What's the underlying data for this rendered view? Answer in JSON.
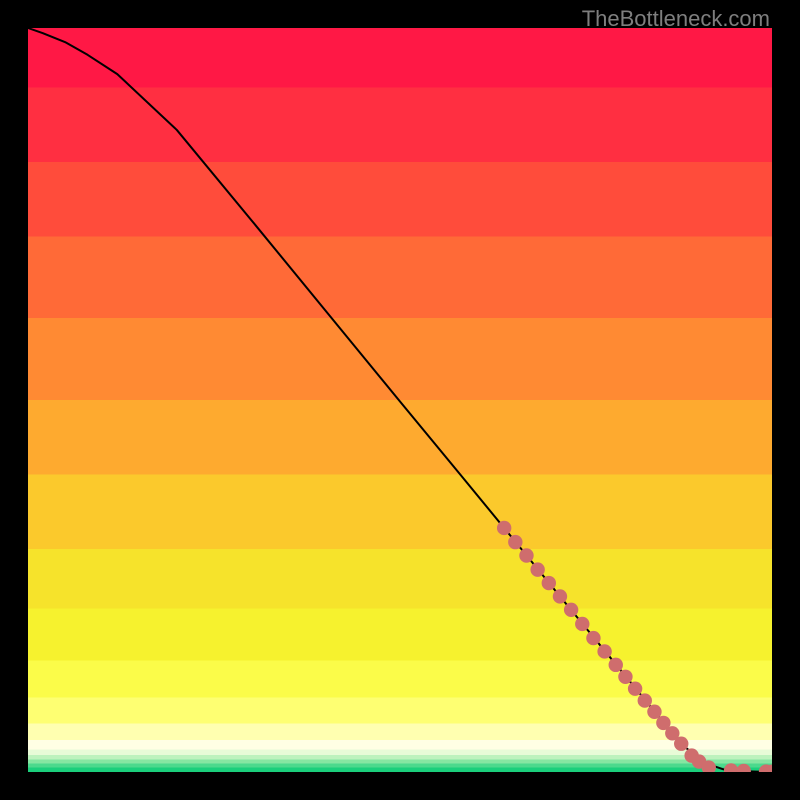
{
  "watermark_text": "TheBottleneck.com",
  "colors": {
    "background": "#000000",
    "watermark": "#7e7e7e",
    "curve": "#000000",
    "dot_fill": "#cf6d6d",
    "dot_stroke": "#b85a5a"
  },
  "chart_data": {
    "type": "line",
    "title": "",
    "xlabel": "",
    "ylabel": "",
    "xlim": [
      0,
      100
    ],
    "ylim": [
      0,
      100
    ],
    "comment": "Axes are unlabeled in the source image; values are the chart's internal 0–100 coordinate space read from the pixel positions of the curve and dots.",
    "series": [
      {
        "name": "curve",
        "kind": "line",
        "x": [
          0,
          2,
          5,
          8,
          12,
          20,
          30,
          40,
          50,
          58,
          64,
          72,
          78,
          84,
          88,
          91,
          93.5,
          96,
          98,
          100
        ],
        "y": [
          100,
          99.3,
          98.1,
          96.4,
          93.8,
          86.3,
          74.2,
          62.0,
          49.8,
          40.1,
          32.8,
          23.0,
          15.7,
          8.4,
          3.6,
          1.2,
          0.35,
          0.12,
          0.05,
          0.04
        ]
      },
      {
        "name": "dots",
        "kind": "scatter",
        "x": [
          64.0,
          65.5,
          67.0,
          68.5,
          70.0,
          71.5,
          73.0,
          74.5,
          76.0,
          77.5,
          79.0,
          80.3,
          81.6,
          82.9,
          84.2,
          85.4,
          86.6,
          87.8,
          89.2,
          90.2,
          91.5,
          94.5,
          96.2,
          99.2,
          100.0
        ],
        "y": [
          32.8,
          30.9,
          29.1,
          27.2,
          25.4,
          23.6,
          21.8,
          19.9,
          18.0,
          16.2,
          14.4,
          12.8,
          11.2,
          9.6,
          8.1,
          6.6,
          5.2,
          3.8,
          2.2,
          1.4,
          0.6,
          0.2,
          0.14,
          0.05,
          0.04
        ]
      }
    ],
    "background_bands": [
      {
        "color": "#ff1845",
        "from_y": 100,
        "to_y": 92
      },
      {
        "color": "#ff2f41",
        "from_y": 92,
        "to_y": 82
      },
      {
        "color": "#ff4c3b",
        "from_y": 82,
        "to_y": 72
      },
      {
        "color": "#ff6a37",
        "from_y": 72,
        "to_y": 61
      },
      {
        "color": "#ff8a33",
        "from_y": 61,
        "to_y": 50
      },
      {
        "color": "#feaa2f",
        "from_y": 50,
        "to_y": 40
      },
      {
        "color": "#fbc92c",
        "from_y": 40,
        "to_y": 30
      },
      {
        "color": "#f6e32b",
        "from_y": 30,
        "to_y": 22
      },
      {
        "color": "#f6f22e",
        "from_y": 22,
        "to_y": 15
      },
      {
        "color": "#fbfc49",
        "from_y": 15,
        "to_y": 10
      },
      {
        "color": "#feff72",
        "from_y": 10,
        "to_y": 6.5
      },
      {
        "color": "#ffffb0",
        "from_y": 6.5,
        "to_y": 4.3
      },
      {
        "color": "#ffffe4",
        "from_y": 4.3,
        "to_y": 3.0
      },
      {
        "color": "#e8fbd7",
        "from_y": 3.0,
        "to_y": 2.3
      },
      {
        "color": "#bdf2bd",
        "from_y": 2.3,
        "to_y": 1.7
      },
      {
        "color": "#86e6a2",
        "from_y": 1.7,
        "to_y": 1.15
      },
      {
        "color": "#4cd98d",
        "from_y": 1.15,
        "to_y": 0.6
      },
      {
        "color": "#1bcf7c",
        "from_y": 0.6,
        "to_y": 0.0
      }
    ]
  }
}
